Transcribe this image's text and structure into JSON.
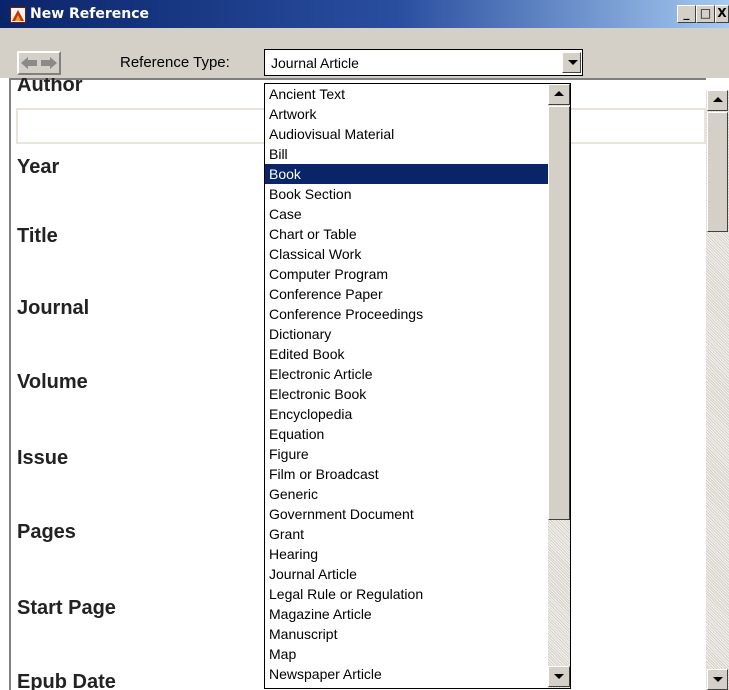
{
  "window": {
    "title": "New Reference",
    "minimize_glyph": "_",
    "maximize_glyph": "□",
    "close_glyph": "X"
  },
  "toolbar": {
    "reference_type_label": "Reference Type:",
    "reference_type_value": "Journal Article"
  },
  "form": {
    "author_label": "Author",
    "fields": [
      "Year",
      "Title",
      "Journal",
      "Volume",
      "Issue",
      "Pages",
      "Start Page",
      "Epub Date"
    ]
  },
  "dropdown": {
    "selected": "Book",
    "options": [
      "Ancient Text",
      "Artwork",
      "Audiovisual Material",
      "Bill",
      "Book",
      "Book Section",
      "Case",
      "Chart or Table",
      "Classical Work",
      "Computer Program",
      "Conference Paper",
      "Conference Proceedings",
      "Dictionary",
      "Edited Book",
      "Electronic Article",
      "Electronic Book",
      "Encyclopedia",
      "Equation",
      "Figure",
      "Film or Broadcast",
      "Generic",
      "Government Document",
      "Grant",
      "Hearing",
      "Journal Article",
      "Legal Rule or Regulation",
      "Magazine Article",
      "Manuscript",
      "Map",
      "Newspaper Article"
    ]
  },
  "colors": {
    "titlebar": "#0a246a",
    "selection": "#0a246a",
    "chrome": "#d4d0c8"
  }
}
